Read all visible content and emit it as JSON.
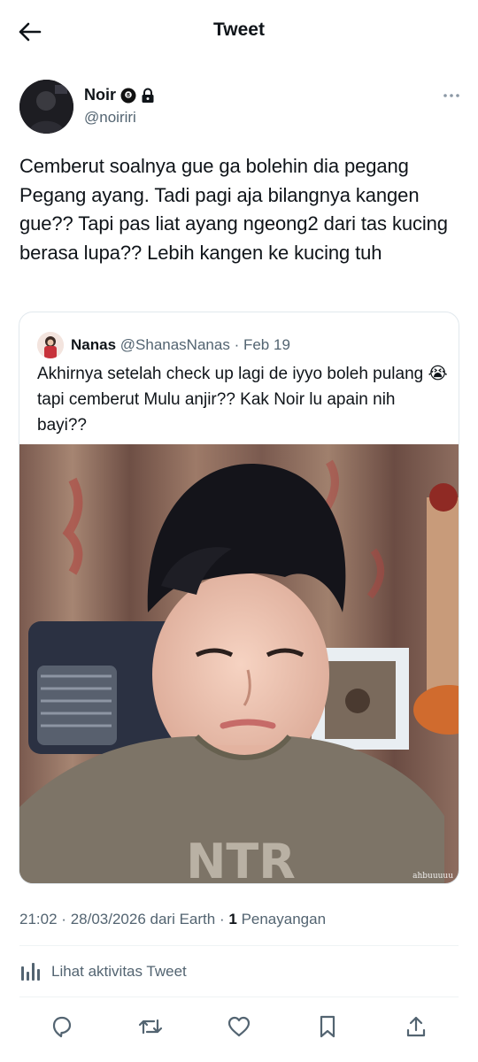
{
  "header": {
    "title": "Tweet"
  },
  "author": {
    "name": "Noir",
    "handle": "@noiriri",
    "badges": [
      "8-ball-emoji",
      "lock-icon"
    ]
  },
  "tweet": {
    "text": "Cemberut soalnya gue ga bolehin dia pegang Pegang ayang. Tadi pagi aja bilangnya kangen gue?? Tapi pas liat ayang ngeong2 dari tas kucing berasa lupa?? Lebih kangen ke kucing tuh"
  },
  "quote": {
    "name": "Nanas",
    "handle": "@ShanasNanas",
    "separator": "·",
    "date": "Feb 19",
    "text_part1": "Akhirnya setelah check up lagi de iyyo boleh pulang",
    "emoji": "😭",
    "text_part2": "tapi cemberut Mulu anjir?? Kak Noir lu apain nih bayi??",
    "image_watermark": "ahbuuuuu"
  },
  "meta": {
    "time": "21:02",
    "sep1": "·",
    "date": "28/03/2026",
    "source": "dari Earth",
    "sep2": "·",
    "views_count": "1",
    "views_label": "Penayangan"
  },
  "activity": {
    "label": "Lihat aktivitas Tweet"
  },
  "actions": [
    "reply-icon",
    "retweet-icon",
    "like-icon",
    "bookmark-icon",
    "share-icon"
  ],
  "colors": {
    "text": "#0f1419",
    "secondary": "#536471",
    "border": "#e1e8ed"
  }
}
